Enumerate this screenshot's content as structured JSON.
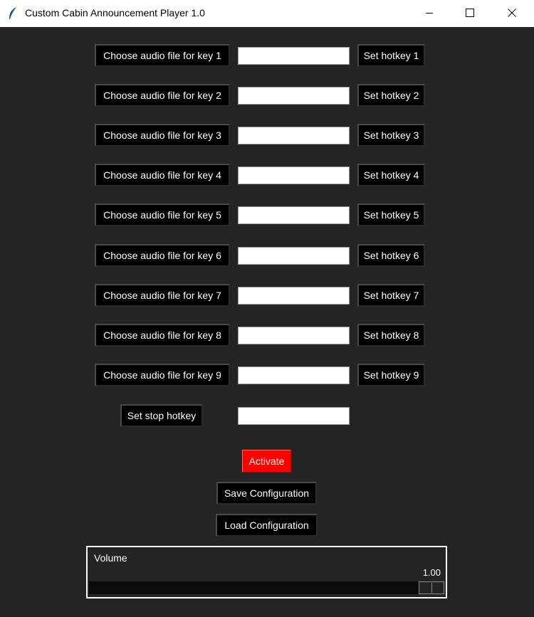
{
  "window": {
    "title": "Custom Cabin Announcement Player 1.0",
    "app_icon": "feather-icon"
  },
  "keys": [
    {
      "choose_label": "Choose audio file for key 1",
      "file_path": "",
      "hotkey_label": "Set hotkey 1"
    },
    {
      "choose_label": "Choose audio file for key 2",
      "file_path": "",
      "hotkey_label": "Set hotkey 2"
    },
    {
      "choose_label": "Choose audio file for key 3",
      "file_path": "",
      "hotkey_label": "Set hotkey 3"
    },
    {
      "choose_label": "Choose audio file for key 4",
      "file_path": "",
      "hotkey_label": "Set hotkey 4"
    },
    {
      "choose_label": "Choose audio file for key 5",
      "file_path": "",
      "hotkey_label": "Set hotkey 5"
    },
    {
      "choose_label": "Choose audio file for key 6",
      "file_path": "",
      "hotkey_label": "Set hotkey 6"
    },
    {
      "choose_label": "Choose audio file for key 7",
      "file_path": "",
      "hotkey_label": "Set hotkey 7"
    },
    {
      "choose_label": "Choose audio file for key 8",
      "file_path": "",
      "hotkey_label": "Set hotkey 8"
    },
    {
      "choose_label": "Choose audio file for key 9",
      "file_path": "",
      "hotkey_label": "Set hotkey 9"
    }
  ],
  "stop": {
    "button_label": "Set stop hotkey",
    "hotkey_value": ""
  },
  "actions": {
    "activate_label": "Activate",
    "save_label": "Save Configuration",
    "load_label": "Load Configuration"
  },
  "volume": {
    "label": "Volume",
    "value": "1.00",
    "level": 1.0
  },
  "colors": {
    "background": "#242424",
    "button": "#000000",
    "activate": "#ff0000",
    "text": "#ffffff"
  }
}
